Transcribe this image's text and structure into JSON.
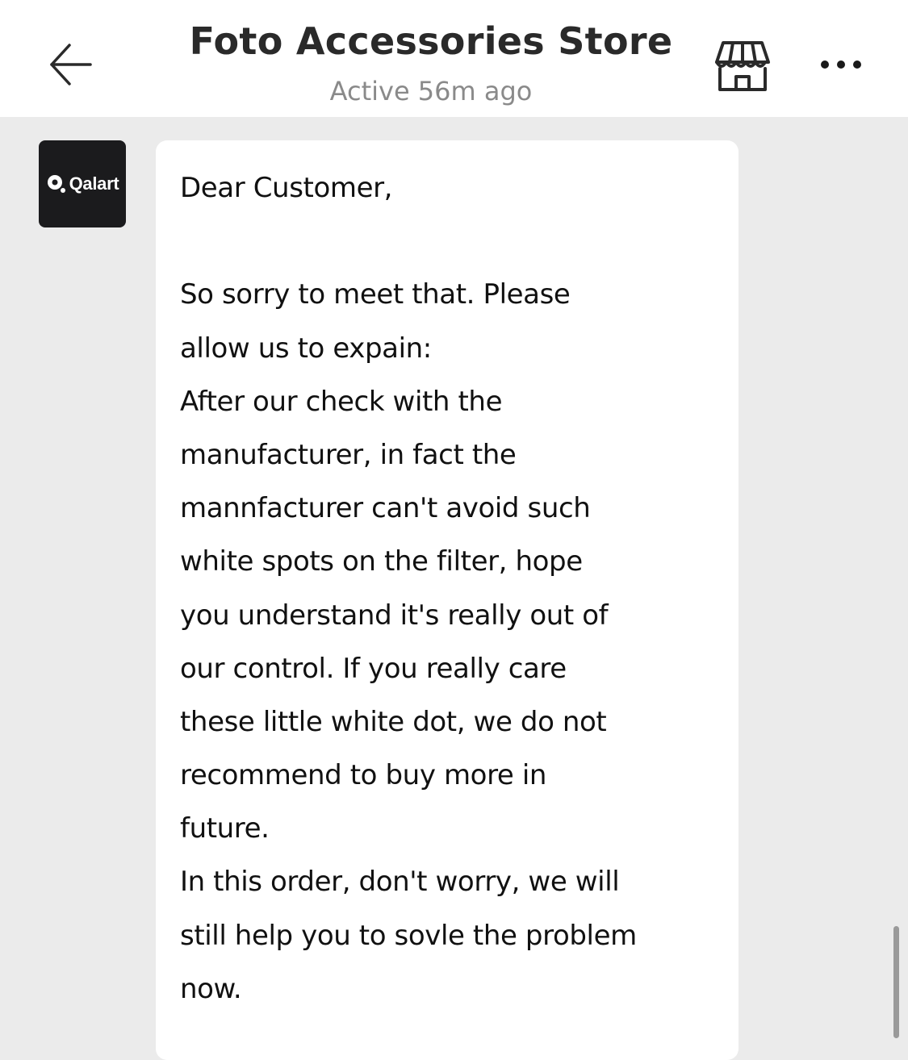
{
  "header": {
    "title": "Foto Accessories Store",
    "status": "Active 56m ago",
    "back_icon": "arrow-left-icon",
    "store_icon": "storefront-icon",
    "more_icon": "more-dots-icon"
  },
  "chat": {
    "avatar_text": "Qalart",
    "message_lines": [
      "Dear Customer,",
      "",
      "So sorry to meet that. Please",
      "allow us to expain:",
      "After our check with the",
      "manufacturer, in fact the",
      "mannfacturer can't avoid such",
      "white spots on the filter, hope",
      "you understand it's really out of",
      "our control. If you really care",
      "these little white dot, we do not",
      "recommend to buy more in",
      "future.",
      "In this order, don't worry, we will",
      "still help you to sovle the problem",
      "now."
    ]
  },
  "colors": {
    "background": "#ebebeb",
    "header_bg": "#ffffff",
    "bubble_bg": "#ffffff",
    "avatar_bg": "#1b1b1d",
    "text": "#111111",
    "muted": "#8a8a8a"
  }
}
